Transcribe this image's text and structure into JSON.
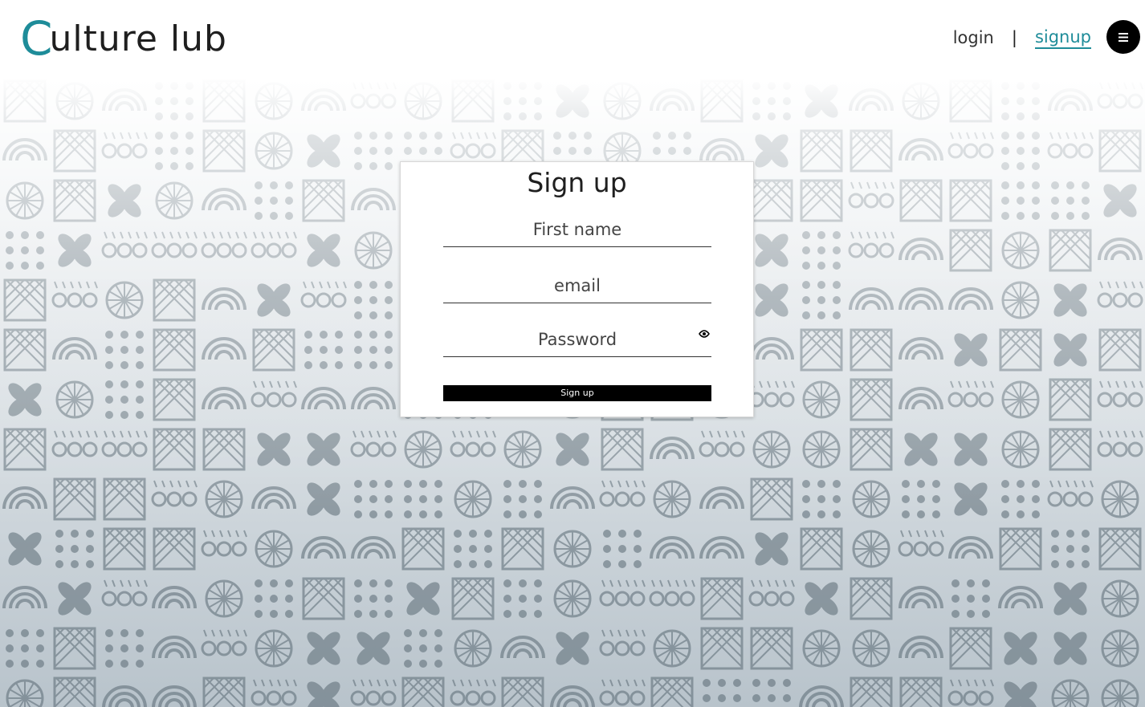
{
  "header": {
    "logo_initial": "C",
    "logo_rest": "ulture lub",
    "nav": {
      "login_label": "login",
      "separator": "|",
      "signup_label": "signup"
    },
    "menu_icon": "hamburger-icon"
  },
  "form": {
    "title": "Sign up",
    "first_name": {
      "value": "",
      "placeholder": "First name"
    },
    "email": {
      "value": "",
      "placeholder": "email"
    },
    "password": {
      "value": "",
      "placeholder": "Password",
      "toggle_icon": "eye-icon"
    },
    "submit_label": "Sign up"
  },
  "colors": {
    "accent": "#1e8c99",
    "button": "#000000",
    "text": "#1f1f1f"
  }
}
